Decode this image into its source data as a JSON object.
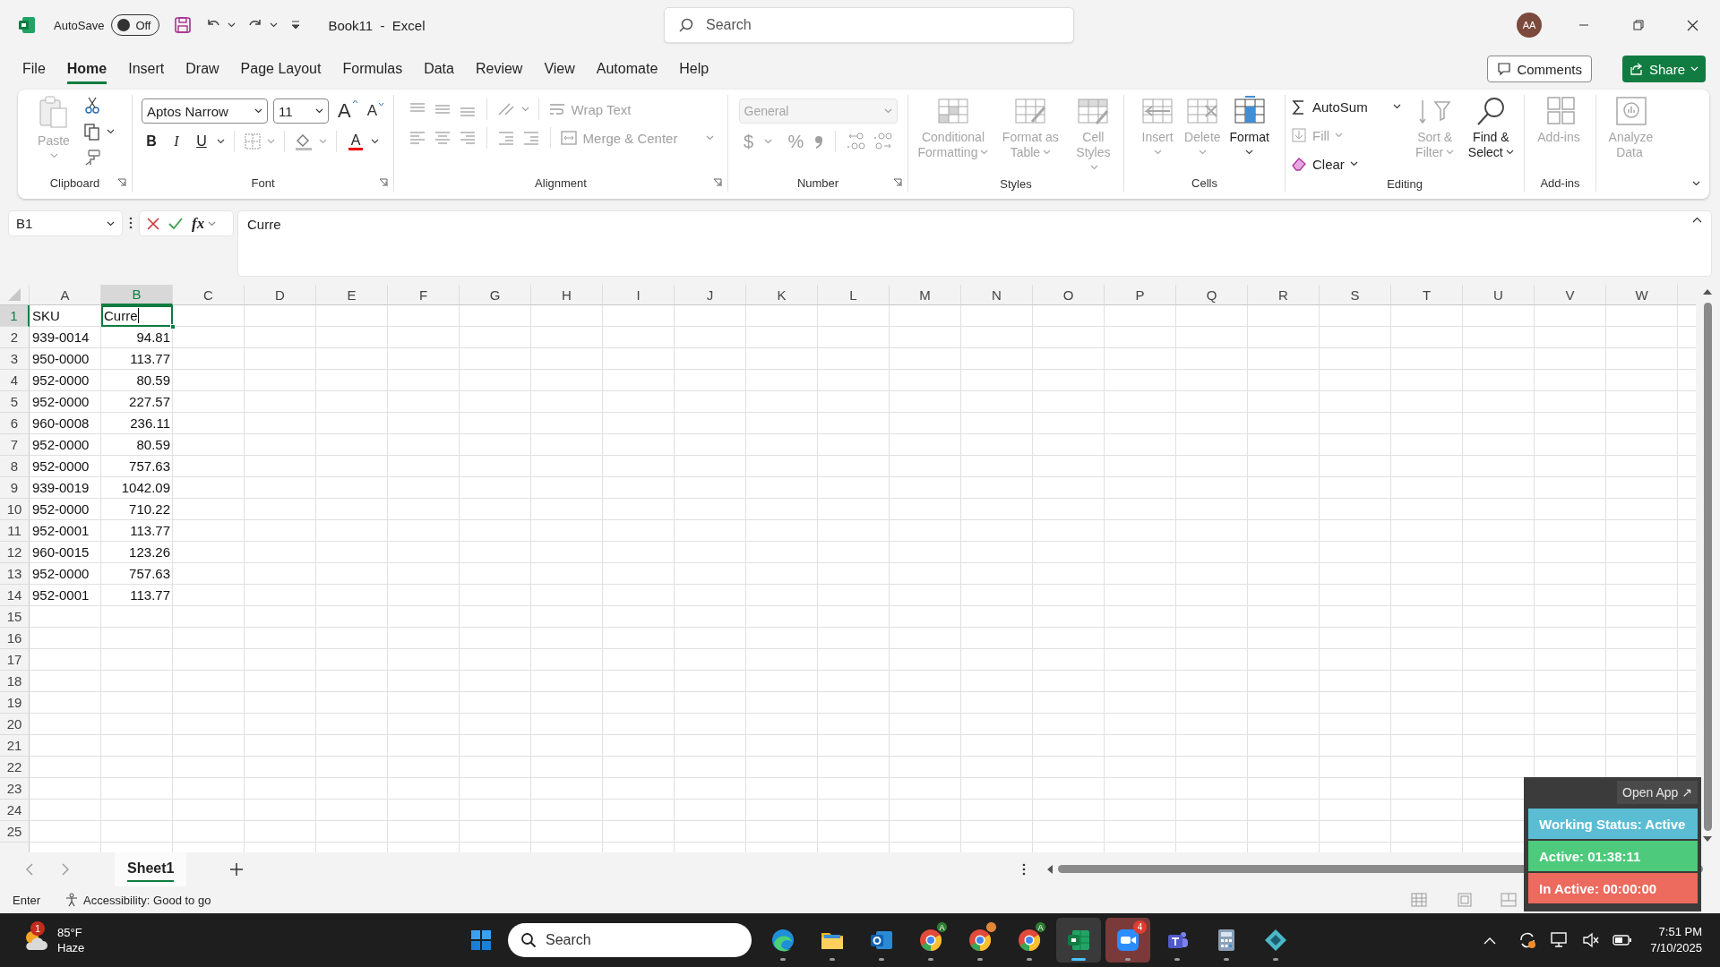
{
  "title_bar": {
    "autosave_label": "AutoSave",
    "autosave_toggle": {
      "label": "Off",
      "on": false
    },
    "document_title": "Book11  -  Excel",
    "search": {
      "placeholder": "Search"
    },
    "avatar": "AA"
  },
  "menu_tabs": [
    {
      "label": "File",
      "selected": false
    },
    {
      "label": "Home",
      "selected": true
    },
    {
      "label": "Insert",
      "selected": false
    },
    {
      "label": "Draw",
      "selected": false
    },
    {
      "label": "Page Layout",
      "selected": false
    },
    {
      "label": "Formulas",
      "selected": false
    },
    {
      "label": "Data",
      "selected": false
    },
    {
      "label": "Review",
      "selected": false
    },
    {
      "label": "View",
      "selected": false
    },
    {
      "label": "Automate",
      "selected": false
    },
    {
      "label": "Help",
      "selected": false
    }
  ],
  "comments_button": "Comments",
  "share_button": "Share",
  "ribbon": {
    "groups": [
      {
        "kind": "clipboard",
        "label": "Clipboard",
        "paste": {
          "label": "Paste",
          "disabled": true
        }
      },
      {
        "kind": "font",
        "label": "Font",
        "disabled": false,
        "font_name": "Aptos Narrow",
        "font_size": "11",
        "grow_font": "A",
        "shrink_font": "A",
        "bold": "B",
        "italic": "I",
        "underline": "U",
        "font_color": "A"
      },
      {
        "kind": "alignment",
        "label": "Alignment",
        "disabled": true,
        "wrap_text": "Wrap Text",
        "merge": "Merge & Center"
      },
      {
        "kind": "number",
        "label": "Number",
        "disabled": true,
        "format": "General",
        "currency": "$",
        "percent": "%"
      },
      {
        "kind": "large",
        "label": "Styles",
        "buttons": [
          {
            "kind": "conditional",
            "label": "Conditional Formatting",
            "disabled": true
          },
          {
            "kind": "table",
            "label": "Format as Table",
            "disabled": true
          },
          {
            "kind": "cellstyles",
            "label": "Cell Styles",
            "disabled": true
          }
        ]
      },
      {
        "kind": "large",
        "label": "Cells",
        "buttons": [
          {
            "kind": "insert",
            "label": "Insert",
            "disabled": true
          },
          {
            "kind": "delete",
            "label": "Delete",
            "disabled": true
          },
          {
            "kind": "format",
            "label": "Format",
            "disabled": false
          }
        ]
      },
      {
        "kind": "editing",
        "label": "Editing",
        "small_buttons": [
          {
            "kind": "autosum",
            "label": "AutoSum",
            "disabled": false
          },
          {
            "kind": "fill",
            "label": "Fill",
            "disabled": true
          },
          {
            "kind": "clear",
            "label": "Clear",
            "disabled": false
          }
        ],
        "buttons": [
          {
            "kind": "sort",
            "label": "Sort & Filter",
            "disabled": true
          },
          {
            "kind": "find",
            "label": "Find & Select",
            "disabled": false
          }
        ]
      },
      {
        "kind": "large",
        "label": "Add-ins",
        "buttons": [
          {
            "kind": "addins",
            "label": "Add-ins",
            "disabled": true
          }
        ]
      },
      {
        "kind": "large",
        "buttons": [
          {
            "kind": "analyze",
            "label": "Analyze Data",
            "disabled": true
          }
        ]
      }
    ]
  },
  "formula_bar": {
    "name_box": "B1",
    "function_label": "fx",
    "value": "Curre"
  },
  "sheet": {
    "columns": [
      {
        "label": "A",
        "selected": false
      },
      {
        "label": "B",
        "selected": true
      },
      {
        "label": "C",
        "selected": false
      },
      {
        "label": "D",
        "selected": false
      },
      {
        "label": "E",
        "selected": false
      },
      {
        "label": "F",
        "selected": false
      },
      {
        "label": "G",
        "selected": false
      },
      {
        "label": "H",
        "selected": false
      },
      {
        "label": "I",
        "selected": false
      },
      {
        "label": "J",
        "selected": false
      },
      {
        "label": "K",
        "selected": false
      },
      {
        "label": "L",
        "selected": false
      },
      {
        "label": "M",
        "selected": false
      },
      {
        "label": "N",
        "selected": false
      },
      {
        "label": "O",
        "selected": false
      },
      {
        "label": "P",
        "selected": false
      },
      {
        "label": "Q",
        "selected": false
      },
      {
        "label": "R",
        "selected": false
      },
      {
        "label": "S",
        "selected": false
      },
      {
        "label": "T",
        "selected": false
      },
      {
        "label": "U",
        "selected": false
      },
      {
        "label": "V",
        "selected": false
      },
      {
        "label": "W",
        "selected": false
      }
    ],
    "rows": [
      {
        "label": "1",
        "selected": true,
        "cells": [
          {
            "text": "SKU",
            "kind": "text"
          },
          {
            "text": "Curre",
            "kind": "text"
          }
        ]
      },
      {
        "label": "2",
        "selected": false,
        "cells": [
          {
            "text": "939-0014",
            "kind": "text"
          },
          {
            "text": "94.81",
            "kind": "number"
          }
        ]
      },
      {
        "label": "3",
        "selected": false,
        "cells": [
          {
            "text": "950-0000",
            "kind": "text"
          },
          {
            "text": "113.77",
            "kind": "number"
          }
        ]
      },
      {
        "label": "4",
        "selected": false,
        "cells": [
          {
            "text": "952-0000",
            "kind": "text"
          },
          {
            "text": "80.59",
            "kind": "number"
          }
        ]
      },
      {
        "label": "5",
        "selected": false,
        "cells": [
          {
            "text": "952-0000",
            "kind": "text"
          },
          {
            "text": "227.57",
            "kind": "number"
          }
        ]
      },
      {
        "label": "6",
        "selected": false,
        "cells": [
          {
            "text": "960-0008",
            "kind": "text"
          },
          {
            "text": "236.11",
            "kind": "number"
          }
        ]
      },
      {
        "label": "7",
        "selected": false,
        "cells": [
          {
            "text": "952-0000",
            "kind": "text"
          },
          {
            "text": "80.59",
            "kind": "number"
          }
        ]
      },
      {
        "label": "8",
        "selected": false,
        "cells": [
          {
            "text": "952-0000",
            "kind": "text"
          },
          {
            "text": "757.63",
            "kind": "number"
          }
        ]
      },
      {
        "label": "9",
        "selected": false,
        "cells": [
          {
            "text": "939-0019",
            "kind": "text"
          },
          {
            "text": "1042.09",
            "kind": "number"
          }
        ]
      },
      {
        "label": "10",
        "selected": false,
        "cells": [
          {
            "text": "952-0000",
            "kind": "text"
          },
          {
            "text": "710.22",
            "kind": "number"
          }
        ]
      },
      {
        "label": "11",
        "selected": false,
        "cells": [
          {
            "text": "952-0001",
            "kind": "text"
          },
          {
            "text": "113.77",
            "kind": "number"
          }
        ]
      },
      {
        "label": "12",
        "selected": false,
        "cells": [
          {
            "text": "960-0015",
            "kind": "text"
          },
          {
            "text": "123.26",
            "kind": "number"
          }
        ]
      },
      {
        "label": "13",
        "selected": false,
        "cells": [
          {
            "text": "952-0000",
            "kind": "text"
          },
          {
            "text": "757.63",
            "kind": "number"
          }
        ]
      },
      {
        "label": "14",
        "selected": false,
        "cells": [
          {
            "text": "952-0001",
            "kind": "text"
          },
          {
            "text": "113.77",
            "kind": "number"
          }
        ]
      },
      {
        "label": "15",
        "selected": false
      },
      {
        "label": "16",
        "selected": false
      },
      {
        "label": "17",
        "selected": false
      },
      {
        "label": "18",
        "selected": false
      },
      {
        "label": "19",
        "selected": false
      },
      {
        "label": "20",
        "selected": false
      },
      {
        "label": "21",
        "selected": false
      },
      {
        "label": "22",
        "selected": false
      },
      {
        "label": "23",
        "selected": false
      },
      {
        "label": "24",
        "selected": false
      },
      {
        "label": "25",
        "selected": false
      }
    ]
  },
  "sheet_tabs": [
    {
      "label": "Sheet1",
      "selected": true
    }
  ],
  "status_bar": {
    "mode": "Enter",
    "accessibility": "Accessibility: Good to go"
  },
  "taskbar": {
    "weather": {
      "temperature": "85°F",
      "condition": "Haze",
      "badge": "1"
    },
    "search": {
      "placeholder": "Search"
    },
    "apps": [
      {
        "kind": "start"
      },
      {
        "kind": "edge",
        "running": true
      },
      {
        "kind": "explorer",
        "running": true
      },
      {
        "kind": "outlook",
        "running": true
      },
      {
        "kind": "chrome",
        "running": true,
        "profile": "A"
      },
      {
        "kind": "chrome",
        "running": true
      },
      {
        "kind": "chrome",
        "running": true,
        "profile": "A"
      },
      {
        "kind": "excel",
        "running": true,
        "active": true
      },
      {
        "kind": "zoom",
        "running": true,
        "attention": true,
        "badge": "4"
      },
      {
        "kind": "teams",
        "running": true
      },
      {
        "kind": "calculator",
        "running": true
      },
      {
        "kind": "diamond",
        "running": true
      }
    ],
    "time": "7:51 PM",
    "date": "7/10/2025"
  },
  "tracker": {
    "open_app": "Open App ↗",
    "statuses": [
      {
        "text": "Working Status: Active",
        "color": "#5bbdd3"
      },
      {
        "text": "Active: 01:38:11",
        "color": "#4dca7b"
      },
      {
        "text": "In Active: 00:00:00",
        "color": "#ec6a5e"
      }
    ]
  }
}
